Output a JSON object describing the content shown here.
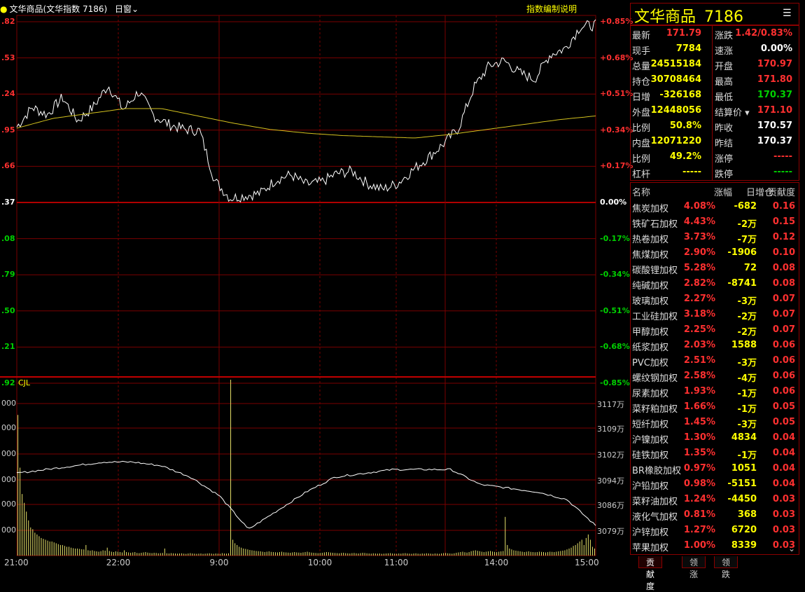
{
  "header": {
    "instrument": "文华商品(文华指数 7186)",
    "period": "日窗",
    "help_link": "指数编制说明",
    "volume_label": "CJL"
  },
  "axis": {
    "price_left": [
      ".82",
      ".53",
      ".24",
      ".95",
      ".66",
      ".37",
      ".08",
      ".79",
      ".50",
      ".21",
      ".92"
    ],
    "pct_right": [
      "+0.85%",
      "+0.68%",
      "+0.51%",
      "+0.34%",
      "+0.17%",
      "0.00%",
      "-0.17%",
      "-0.34%",
      "-0.51%",
      "-0.68%",
      "-0.85%"
    ],
    "vol_left": [
      "000",
      "000",
      "000",
      "000",
      "000",
      "000"
    ],
    "vol_right": [
      "3117万",
      "3109万",
      "3102万",
      "3094万",
      "3086万",
      "3079万"
    ],
    "time": [
      "21:00",
      "22:00",
      "9:00",
      "10:00",
      "11:00",
      "14:00",
      "15:00"
    ]
  },
  "chart_data": {
    "type": "line",
    "price_axis": {
      "prev_close": 170.37,
      "pct_range": [
        -0.85,
        0.85
      ]
    },
    "x": [
      "21:00",
      "22:00",
      "9:00",
      "10:00",
      "11:00",
      "14:00",
      "15:00"
    ],
    "series": [
      {
        "values": [
          170.96,
          171.12,
          171.06,
          171.2,
          171.01,
          171.12,
          171.3,
          171.1,
          171.25,
          171.05,
          170.98,
          170.94,
          170.93,
          170.52,
          170.38,
          170.4,
          170.42,
          170.53,
          170.57,
          170.49,
          170.51,
          170.58,
          170.6,
          170.5,
          170.45,
          170.5,
          170.61,
          170.71,
          170.82,
          170.95,
          171.28,
          171.46,
          171.5,
          171.4,
          171.35,
          171.55,
          171.6,
          171.78,
          171.79
        ]
      },
      {
        "values": [
          170.95,
          171.03,
          171.07,
          171.11,
          171.11,
          171.05,
          170.99,
          170.94,
          170.91,
          170.89,
          170.88,
          170.87,
          170.9,
          170.94,
          170.98,
          171.02,
          171.05
        ]
      }
    ],
    "volume": {
      "values": [
        800,
        500,
        350,
        300,
        250,
        200,
        160,
        150,
        130,
        120,
        110,
        100,
        95,
        90,
        85,
        80,
        80,
        75,
        70,
        65,
        60,
        60,
        55,
        50,
        50,
        45,
        42,
        40,
        40,
        38,
        36,
        35,
        60,
        30,
        28,
        30,
        26,
        24,
        22,
        25,
        30,
        28,
        45,
        26,
        22,
        20,
        24,
        22,
        20,
        18,
        30,
        20,
        18,
        16,
        18,
        20,
        15,
        14,
        16,
        18,
        20,
        17,
        15,
        14,
        16,
        15,
        13,
        14,
        15,
        40,
        13,
        12,
        14,
        13,
        12,
        11,
        12,
        13,
        11,
        10,
        12,
        14,
        12,
        11,
        10,
        11,
        12,
        10,
        11,
        12,
        13,
        11,
        10,
        12,
        11,
        10,
        14,
        12,
        11,
        13,
        1000,
        90,
        70,
        60,
        50,
        45,
        40,
        38,
        35,
        32,
        30,
        28,
        26,
        25,
        24,
        22,
        20,
        22,
        24,
        21,
        20,
        19,
        18,
        20,
        22,
        19,
        18,
        17,
        16,
        18,
        20,
        18,
        17,
        16,
        18,
        20,
        22,
        19,
        17,
        16,
        15,
        14,
        15,
        16,
        18,
        20,
        19,
        17,
        16,
        15,
        14,
        13,
        15,
        16,
        14,
        13,
        12,
        14,
        15,
        13,
        12,
        14,
        16,
        15,
        13,
        12,
        11,
        13,
        12,
        11,
        12,
        10,
        11,
        12,
        13,
        14,
        12,
        11,
        10,
        12,
        11,
        13,
        14,
        12,
        11,
        10,
        12,
        13,
        11,
        10,
        12,
        11,
        13,
        12,
        11,
        10,
        12,
        11,
        10,
        12,
        14,
        15,
        13,
        12,
        11,
        13,
        16,
        18,
        20,
        22,
        19,
        17,
        20,
        25,
        28,
        30,
        27,
        25,
        22,
        20,
        22,
        24,
        26,
        23,
        21,
        20,
        22,
        24,
        26,
        220,
        60,
        40,
        35,
        30,
        28,
        26,
        24,
        22,
        20,
        22,
        24,
        21,
        20,
        19,
        20,
        22,
        21,
        20,
        18,
        20,
        22,
        21,
        20,
        22,
        24,
        26,
        28,
        30,
        35,
        40,
        45,
        55,
        60,
        70,
        80,
        90,
        60,
        100,
        120,
        90,
        50,
        40
      ]
    }
  },
  "quote": {
    "name": "文华商品",
    "code": "7186",
    "menu_icon": "list-icon",
    "rows": [
      {
        "l1": "最新",
        "v1": "171.79",
        "c1": "red",
        "l2": "涨跌",
        "v2": "1.42/0.83%",
        "c2": "red"
      },
      {
        "l1": "现手",
        "v1": "7784",
        "c1": "yel",
        "l2": "速涨",
        "v2": "0.00%",
        "c2": "wht"
      },
      {
        "l1": "总量",
        "v1": "24515184",
        "c1": "yel",
        "l2": "开盘",
        "v2": "170.97",
        "c2": "red"
      },
      {
        "l1": "持仓",
        "v1": "30708464",
        "c1": "yel",
        "l2": "最高",
        "v2": "171.80",
        "c2": "red"
      },
      {
        "l1": "日增",
        "v1": "-326168",
        "c1": "yel",
        "l2": "最低",
        "v2": "170.37",
        "c2": "grn"
      },
      {
        "l1": "外盘",
        "v1": "12448056",
        "c1": "yel",
        "l2": "结算价",
        "v2": "171.10",
        "c2": "red"
      },
      {
        "l1": "比例",
        "v1": "50.8%",
        "c1": "yel",
        "l2": "昨收",
        "v2": "170.57",
        "c2": "wht"
      },
      {
        "l1": "内盘",
        "v1": "12071220",
        "c1": "yel",
        "l2": "昨结",
        "v2": "170.37",
        "c2": "wht"
      },
      {
        "l1": "比例",
        "v1": "49.2%",
        "c1": "yel",
        "l2": "涨停",
        "v2": "-----",
        "c2": "red"
      },
      {
        "l1": "杠杆",
        "v1": "-----",
        "c1": "yel",
        "l2": "跌停",
        "v2": "-----",
        "c2": "grn"
      }
    ]
  },
  "contrib": {
    "headers": [
      "名称",
      "涨幅",
      "日增仓",
      "贡献度"
    ],
    "rows": [
      [
        "焦炭加权",
        "4.08%",
        "-682",
        "0.16"
      ],
      [
        "铁矿石加权",
        "4.43%",
        "-2万",
        "0.15"
      ],
      [
        "热卷加权",
        "3.73%",
        "-7万",
        "0.12"
      ],
      [
        "焦煤加权",
        "2.90%",
        "-1906",
        "0.10"
      ],
      [
        "碳酸锂加权",
        "5.28%",
        "72",
        "0.08"
      ],
      [
        "纯碱加权",
        "2.82%",
        "-8741",
        "0.08"
      ],
      [
        "玻璃加权",
        "2.27%",
        "-3万",
        "0.07"
      ],
      [
        "工业硅加权",
        "3.18%",
        "-2万",
        "0.07"
      ],
      [
        "甲醇加权",
        "2.25%",
        "-2万",
        "0.07"
      ],
      [
        "纸浆加权",
        "2.03%",
        "1588",
        "0.06"
      ],
      [
        "PVC加权",
        "2.51%",
        "-3万",
        "0.06"
      ],
      [
        "螺纹钢加权",
        "2.58%",
        "-4万",
        "0.06"
      ],
      [
        "尿素加权",
        "1.93%",
        "-1万",
        "0.06"
      ],
      [
        "菜籽粕加权",
        "1.66%",
        "-1万",
        "0.05"
      ],
      [
        "短纤加权",
        "1.45%",
        "-3万",
        "0.05"
      ],
      [
        "沪镍加权",
        "1.30%",
        "4834",
        "0.04"
      ],
      [
        "硅铁加权",
        "1.35%",
        "-1万",
        "0.04"
      ],
      [
        "BR橡胶加权",
        "0.97%",
        "1051",
        "0.04"
      ],
      [
        "沪铅加权",
        "0.98%",
        "-5151",
        "0.04"
      ],
      [
        "菜籽油加权",
        "1.24%",
        "-4450",
        "0.03"
      ],
      [
        "液化气加权",
        "0.81%",
        "368",
        "0.03"
      ],
      [
        "沪锌加权",
        "1.27%",
        "6720",
        "0.03"
      ],
      [
        "苹果加权",
        "1.00%",
        "8339",
        "0.03"
      ]
    ],
    "tabs": [
      "贡献度",
      "领涨",
      "领跌"
    ],
    "expand_icon": "chevron-down-icon"
  },
  "colors": {
    "grid": "#7a0000",
    "price_line": "#ffffff",
    "avg_line": "#d4c21e",
    "volume_bar": "#e8e36a",
    "up": "#ff3030",
    "down": "#00d000"
  }
}
